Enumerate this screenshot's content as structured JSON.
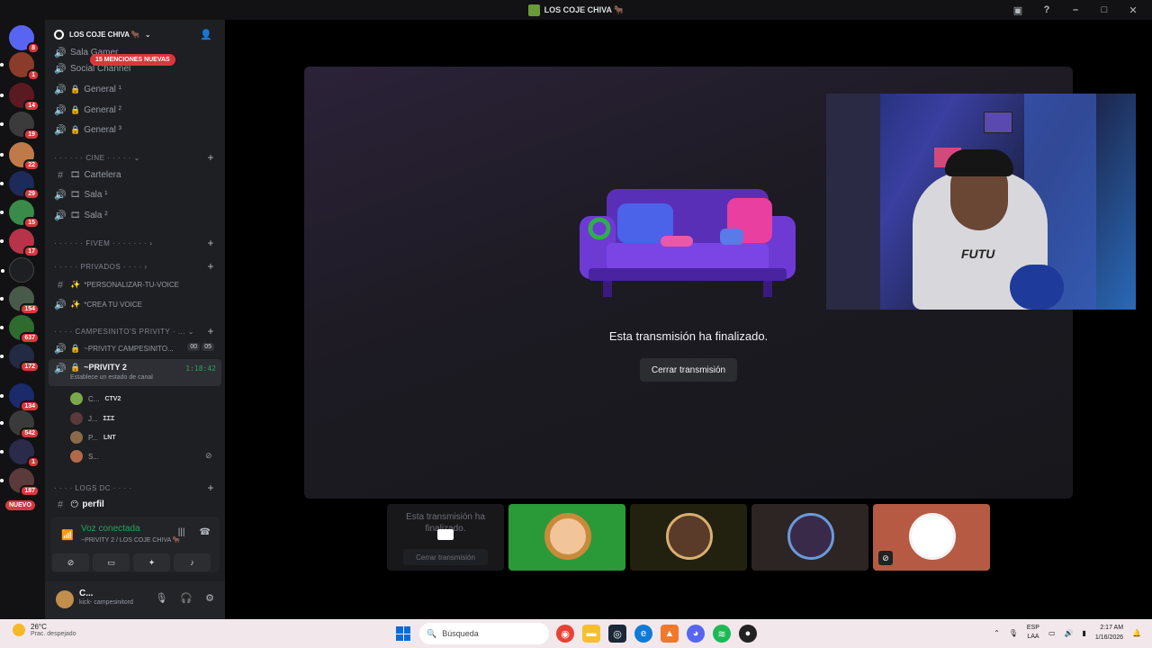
{
  "window": {
    "title": "LOS COJE CHIVA 🐂"
  },
  "rail": {
    "badges": [
      "8",
      "1",
      "14",
      "19",
      "22",
      "29",
      "15",
      "17",
      "154",
      "637",
      "172",
      "134",
      "542",
      "1",
      "187"
    ],
    "new_label": "NUEVO"
  },
  "server": {
    "name": "LOS COJE CHIVA 🐂",
    "mentions": "15 MENCIONES NUEVAS"
  },
  "channels": {
    "sala_gamer": "Sala Gamer",
    "social_channel": "Social Channel",
    "general1": "General ¹",
    "general2": "General ²",
    "general3": "General ³",
    "cat_cine": "CINE",
    "cartelera": "Cartelera",
    "sala1": "Sala ¹",
    "sala2": "Sala ²",
    "cat_fivem": "FIVEM",
    "cat_privados": "PRIVADOS",
    "personalizar": "*PERSONALIZAR-TU-VOICE",
    "crea_voice": "*CREA TU VOICE",
    "cat_campesinito": "CAMPESINITO'S PRIVITY",
    "privity_campesinito": "~PRIVITY CAMPESINITO...",
    "count_a": "00",
    "count_b": "05",
    "privity2": "~PRIVITY 2",
    "privity2_timer": "1:18:42",
    "privity2_status": "Establece un estado de canal",
    "cat_logs": "LOGS DC",
    "perfil": "perfil"
  },
  "voice_users": [
    {
      "name": "C...",
      "tag": "CTV2"
    },
    {
      "name": "J...",
      "tag": "ΣΣΣ"
    },
    {
      "name": "P...",
      "tag": "LNT"
    },
    {
      "name": "S...",
      "tag": ""
    }
  ],
  "voice_panel": {
    "status": "Voz conectada",
    "location": "~PRIVITY 2 / LOS COJE CHIVA 🐂"
  },
  "user": {
    "name": "C...",
    "status": "kick- campesinitord"
  },
  "stage": {
    "ended_text": "Esta transmisión ha finalizado.",
    "close_button": "Cerrar transmisión"
  },
  "tiles": {
    "ended_text": "Esta transmisión ha finalizado.",
    "close_button": "Cerrar transmisión"
  },
  "taskbar": {
    "temp": "26°C",
    "condition": "Prac. despejado",
    "search_placeholder": "Búsqueda",
    "lang_top": "ESP",
    "lang_bottom": "LAA",
    "time": "2:17 AM",
    "date": "1/16/2026"
  }
}
